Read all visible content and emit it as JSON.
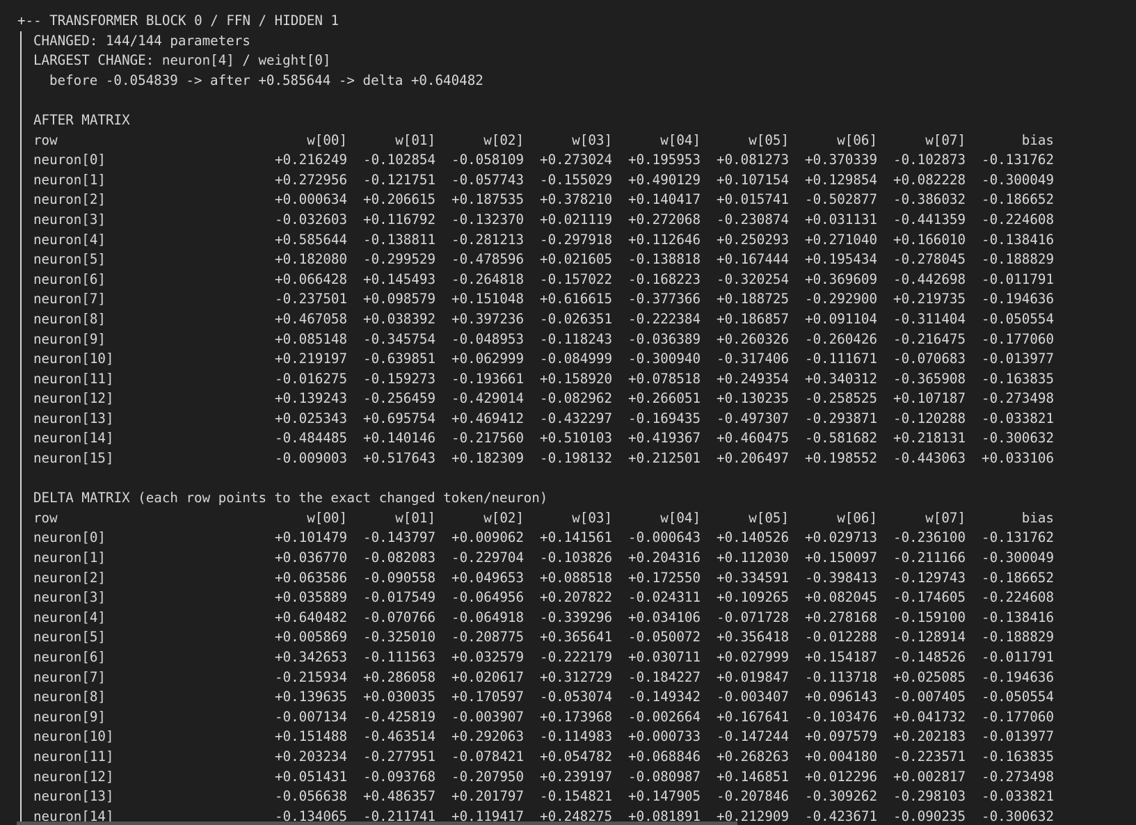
{
  "header": {
    "title": "+-- TRANSFORMER BLOCK 0 / FFN / HIDDEN 1",
    "changed": "CHANGED: 144/144 parameters",
    "largest": "LARGEST CHANGE: neuron[4] / weight[0]",
    "detail": "before -0.054839 -> after +0.585644 -> delta +0.640482"
  },
  "columns": [
    "row",
    "w[00]",
    "w[01]",
    "w[02]",
    "w[03]",
    "w[04]",
    "w[05]",
    "w[06]",
    "w[07]",
    "bias"
  ],
  "after": {
    "title": "AFTER MATRIX",
    "rows": [
      {
        "label": "neuron[0]",
        "values": [
          "+0.216249",
          "-0.102854",
          "-0.058109",
          "+0.273024",
          "+0.195953",
          "+0.081273",
          "+0.370339",
          "-0.102873",
          "-0.131762"
        ]
      },
      {
        "label": "neuron[1]",
        "values": [
          "+0.272956",
          "-0.121751",
          "-0.057743",
          "-0.155029",
          "+0.490129",
          "+0.107154",
          "+0.129854",
          "+0.082228",
          "-0.300049"
        ]
      },
      {
        "label": "neuron[2]",
        "values": [
          "+0.000634",
          "+0.206615",
          "+0.187535",
          "+0.378210",
          "+0.140417",
          "+0.015741",
          "-0.502877",
          "-0.386032",
          "-0.186652"
        ]
      },
      {
        "label": "neuron[3]",
        "values": [
          "-0.032603",
          "+0.116792",
          "-0.132370",
          "+0.021119",
          "+0.272068",
          "-0.230874",
          "+0.031131",
          "-0.441359",
          "-0.224608"
        ]
      },
      {
        "label": "neuron[4]",
        "values": [
          "+0.585644",
          "-0.138811",
          "-0.281213",
          "-0.297918",
          "+0.112646",
          "+0.250293",
          "+0.271040",
          "+0.166010",
          "-0.138416"
        ]
      },
      {
        "label": "neuron[5]",
        "values": [
          "+0.182080",
          "-0.299529",
          "-0.478596",
          "+0.021605",
          "-0.138818",
          "+0.167444",
          "+0.195434",
          "-0.278045",
          "-0.188829"
        ]
      },
      {
        "label": "neuron[6]",
        "values": [
          "+0.066428",
          "+0.145493",
          "-0.264818",
          "-0.157022",
          "-0.168223",
          "-0.320254",
          "+0.369609",
          "-0.442698",
          "-0.011791"
        ]
      },
      {
        "label": "neuron[7]",
        "values": [
          "-0.237501",
          "+0.098579",
          "+0.151048",
          "+0.616615",
          "-0.377366",
          "+0.188725",
          "-0.292900",
          "+0.219735",
          "-0.194636"
        ]
      },
      {
        "label": "neuron[8]",
        "values": [
          "+0.467058",
          "+0.038392",
          "+0.397236",
          "-0.026351",
          "-0.222384",
          "+0.186857",
          "+0.091104",
          "-0.311404",
          "-0.050554"
        ]
      },
      {
        "label": "neuron[9]",
        "values": [
          "+0.085148",
          "-0.345754",
          "-0.048953",
          "-0.118243",
          "-0.036389",
          "+0.260326",
          "-0.260426",
          "-0.216475",
          "-0.177060"
        ]
      },
      {
        "label": "neuron[10]",
        "values": [
          "+0.219197",
          "-0.639851",
          "+0.062999",
          "-0.084999",
          "-0.300940",
          "-0.317406",
          "-0.111671",
          "-0.070683",
          "-0.013977"
        ]
      },
      {
        "label": "neuron[11]",
        "values": [
          "-0.016275",
          "-0.159273",
          "-0.193661",
          "+0.158920",
          "+0.078518",
          "+0.249354",
          "+0.340312",
          "-0.365908",
          "-0.163835"
        ]
      },
      {
        "label": "neuron[12]",
        "values": [
          "+0.139243",
          "-0.256459",
          "-0.429014",
          "-0.082962",
          "+0.266051",
          "+0.130235",
          "-0.258525",
          "+0.107187",
          "-0.273498"
        ]
      },
      {
        "label": "neuron[13]",
        "values": [
          "+0.025343",
          "+0.695754",
          "+0.469412",
          "-0.432297",
          "-0.169435",
          "-0.497307",
          "-0.293871",
          "-0.120288",
          "-0.033821"
        ]
      },
      {
        "label": "neuron[14]",
        "values": [
          "-0.484485",
          "+0.140146",
          "-0.217560",
          "+0.510103",
          "+0.419367",
          "+0.460475",
          "-0.581682",
          "+0.218131",
          "-0.300632"
        ]
      },
      {
        "label": "neuron[15]",
        "values": [
          "-0.009003",
          "+0.517643",
          "+0.182309",
          "-0.198132",
          "+0.212501",
          "+0.206497",
          "+0.198552",
          "-0.443063",
          "+0.033106"
        ]
      }
    ]
  },
  "delta": {
    "title": "DELTA MATRIX (each row points to the exact changed token/neuron)",
    "rows": [
      {
        "label": "neuron[0]",
        "values": [
          "+0.101479",
          "-0.143797",
          "+0.009062",
          "+0.141561",
          "-0.000643",
          "+0.140526",
          "+0.029713",
          "-0.236100",
          "-0.131762"
        ]
      },
      {
        "label": "neuron[1]",
        "values": [
          "+0.036770",
          "-0.082083",
          "-0.229704",
          "-0.103826",
          "+0.204316",
          "+0.112030",
          "+0.150097",
          "-0.211166",
          "-0.300049"
        ]
      },
      {
        "label": "neuron[2]",
        "values": [
          "+0.063586",
          "-0.090558",
          "+0.049653",
          "+0.088518",
          "+0.172550",
          "+0.334591",
          "-0.398413",
          "-0.129743",
          "-0.186652"
        ]
      },
      {
        "label": "neuron[3]",
        "values": [
          "+0.035889",
          "-0.017549",
          "-0.064956",
          "+0.207822",
          "-0.024311",
          "+0.109265",
          "+0.082045",
          "-0.174605",
          "-0.224608"
        ]
      },
      {
        "label": "neuron[4]",
        "values": [
          "+0.640482",
          "-0.070766",
          "-0.064918",
          "-0.339296",
          "+0.034106",
          "-0.071728",
          "+0.278168",
          "-0.159100",
          "-0.138416"
        ]
      },
      {
        "label": "neuron[5]",
        "values": [
          "+0.005869",
          "-0.325010",
          "-0.208775",
          "+0.365641",
          "-0.050072",
          "+0.356418",
          "-0.012288",
          "-0.128914",
          "-0.188829"
        ]
      },
      {
        "label": "neuron[6]",
        "values": [
          "+0.342653",
          "-0.111563",
          "+0.032579",
          "-0.222179",
          "+0.030711",
          "+0.027999",
          "+0.154187",
          "-0.148526",
          "-0.011791"
        ]
      },
      {
        "label": "neuron[7]",
        "values": [
          "-0.215934",
          "+0.286058",
          "+0.020617",
          "+0.312729",
          "-0.184227",
          "+0.019847",
          "-0.113718",
          "+0.025085",
          "-0.194636"
        ]
      },
      {
        "label": "neuron[8]",
        "values": [
          "+0.139635",
          "+0.030035",
          "+0.170597",
          "-0.053074",
          "-0.149342",
          "-0.003407",
          "+0.096143",
          "-0.007405",
          "-0.050554"
        ]
      },
      {
        "label": "neuron[9]",
        "values": [
          "-0.007134",
          "-0.425819",
          "-0.003907",
          "+0.173968",
          "-0.002664",
          "+0.167641",
          "-0.103476",
          "+0.041732",
          "-0.177060"
        ]
      },
      {
        "label": "neuron[10]",
        "values": [
          "+0.151488",
          "-0.463514",
          "+0.292063",
          "-0.114983",
          "+0.000733",
          "-0.147244",
          "+0.097579",
          "+0.202183",
          "-0.013977"
        ]
      },
      {
        "label": "neuron[11]",
        "values": [
          "+0.203234",
          "-0.277951",
          "-0.078421",
          "+0.054782",
          "+0.068846",
          "+0.268263",
          "+0.004180",
          "-0.223571",
          "-0.163835"
        ]
      },
      {
        "label": "neuron[12]",
        "values": [
          "+0.051431",
          "-0.093768",
          "-0.207950",
          "+0.239197",
          "-0.080987",
          "+0.146851",
          "+0.012296",
          "+0.002817",
          "-0.273498"
        ]
      },
      {
        "label": "neuron[13]",
        "values": [
          "-0.056638",
          "+0.486357",
          "+0.201797",
          "-0.154821",
          "+0.147905",
          "-0.207846",
          "-0.309262",
          "-0.298103",
          "-0.033821"
        ]
      },
      {
        "label": "neuron[14]",
        "values": [
          "-0.134065",
          "-0.211741",
          "+0.119417",
          "+0.248275",
          "+0.081891",
          "+0.212909",
          "-0.423671",
          "-0.090235",
          "-0.300632"
        ]
      }
    ]
  }
}
